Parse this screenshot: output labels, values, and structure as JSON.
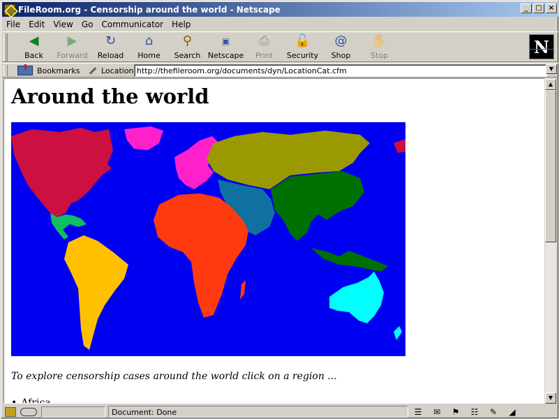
{
  "window": {
    "title": "FileRoom.org - Censorship around the world - Netscape",
    "buttons": {
      "minimize": "_",
      "maximize": "□",
      "close": "×"
    }
  },
  "menu": [
    {
      "label": "File"
    },
    {
      "label": "Edit"
    },
    {
      "label": "View"
    },
    {
      "label": "Go"
    },
    {
      "label": "Communicator"
    },
    {
      "label": "Help"
    }
  ],
  "toolbar": {
    "back": "Back",
    "forward": "Forward",
    "reload": "Reload",
    "home": "Home",
    "search": "Search",
    "netscape": "Netscape",
    "print": "Print",
    "security": "Security",
    "shop": "Shop",
    "stop": "Stop",
    "logo": "N"
  },
  "location_bar": {
    "bookmarks_label": "Bookmarks",
    "location_label": "Location:",
    "url": "http://thefileroom.org/documents/dyn/LocationCat.cfm"
  },
  "page": {
    "heading": "Around the world",
    "intro": "To explore censorship cases around the world click on a region ...",
    "regions": [
      {
        "label": "Africa"
      }
    ]
  },
  "map": {
    "ocean": "#0000f0",
    "regions": [
      {
        "name": "north-america",
        "color": "#cc1040"
      },
      {
        "name": "central-america",
        "color": "#10c060"
      },
      {
        "name": "south-america",
        "color": "#ffc000"
      },
      {
        "name": "europe",
        "color": "#ff20cc"
      },
      {
        "name": "russia",
        "color": "#9a9a00"
      },
      {
        "name": "africa",
        "color": "#ff3a10"
      },
      {
        "name": "middle-east",
        "color": "#1070a0"
      },
      {
        "name": "asia",
        "color": "#007000"
      },
      {
        "name": "oceania",
        "color": "#00ffff"
      }
    ]
  },
  "status": {
    "text": "Document: Done"
  }
}
